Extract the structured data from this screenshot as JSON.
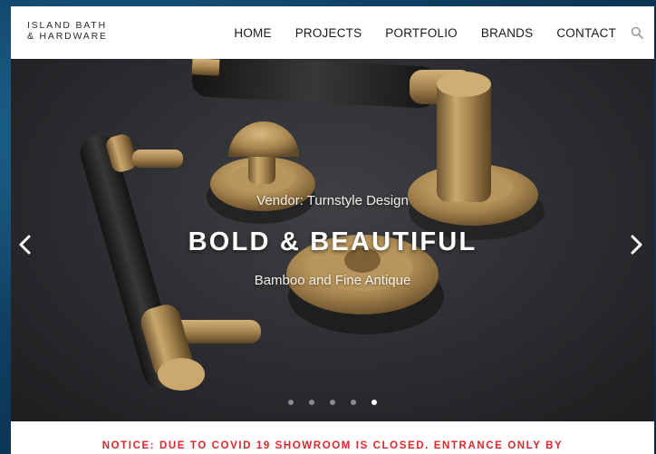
{
  "brand": {
    "line1": "ISLAND BATH",
    "line2": "& HARDWARE"
  },
  "nav": {
    "items": [
      {
        "label": "HOME"
      },
      {
        "label": "PROJECTS"
      },
      {
        "label": "PORTFOLIO"
      },
      {
        "label": "BRANDS"
      },
      {
        "label": "CONTACT"
      }
    ],
    "search_icon": "search-icon"
  },
  "slider": {
    "vendor": "Vendor: Turnstyle Design",
    "title": "BOLD & BEAUTIFUL",
    "subtitle": "Bamboo and Fine Antique",
    "prev_icon": "chevron-left-icon",
    "next_icon": "chevron-right-icon",
    "slide_count": 5,
    "active_slide": 5
  },
  "notice": {
    "text": "NOTICE: DUE TO COVID 19 SHOWROOM IS CLOSED. ENTRANCE ONLY BY"
  },
  "colors": {
    "notice": "#e0262b",
    "brass": "#a9874f",
    "background": "#2b2c2f"
  }
}
